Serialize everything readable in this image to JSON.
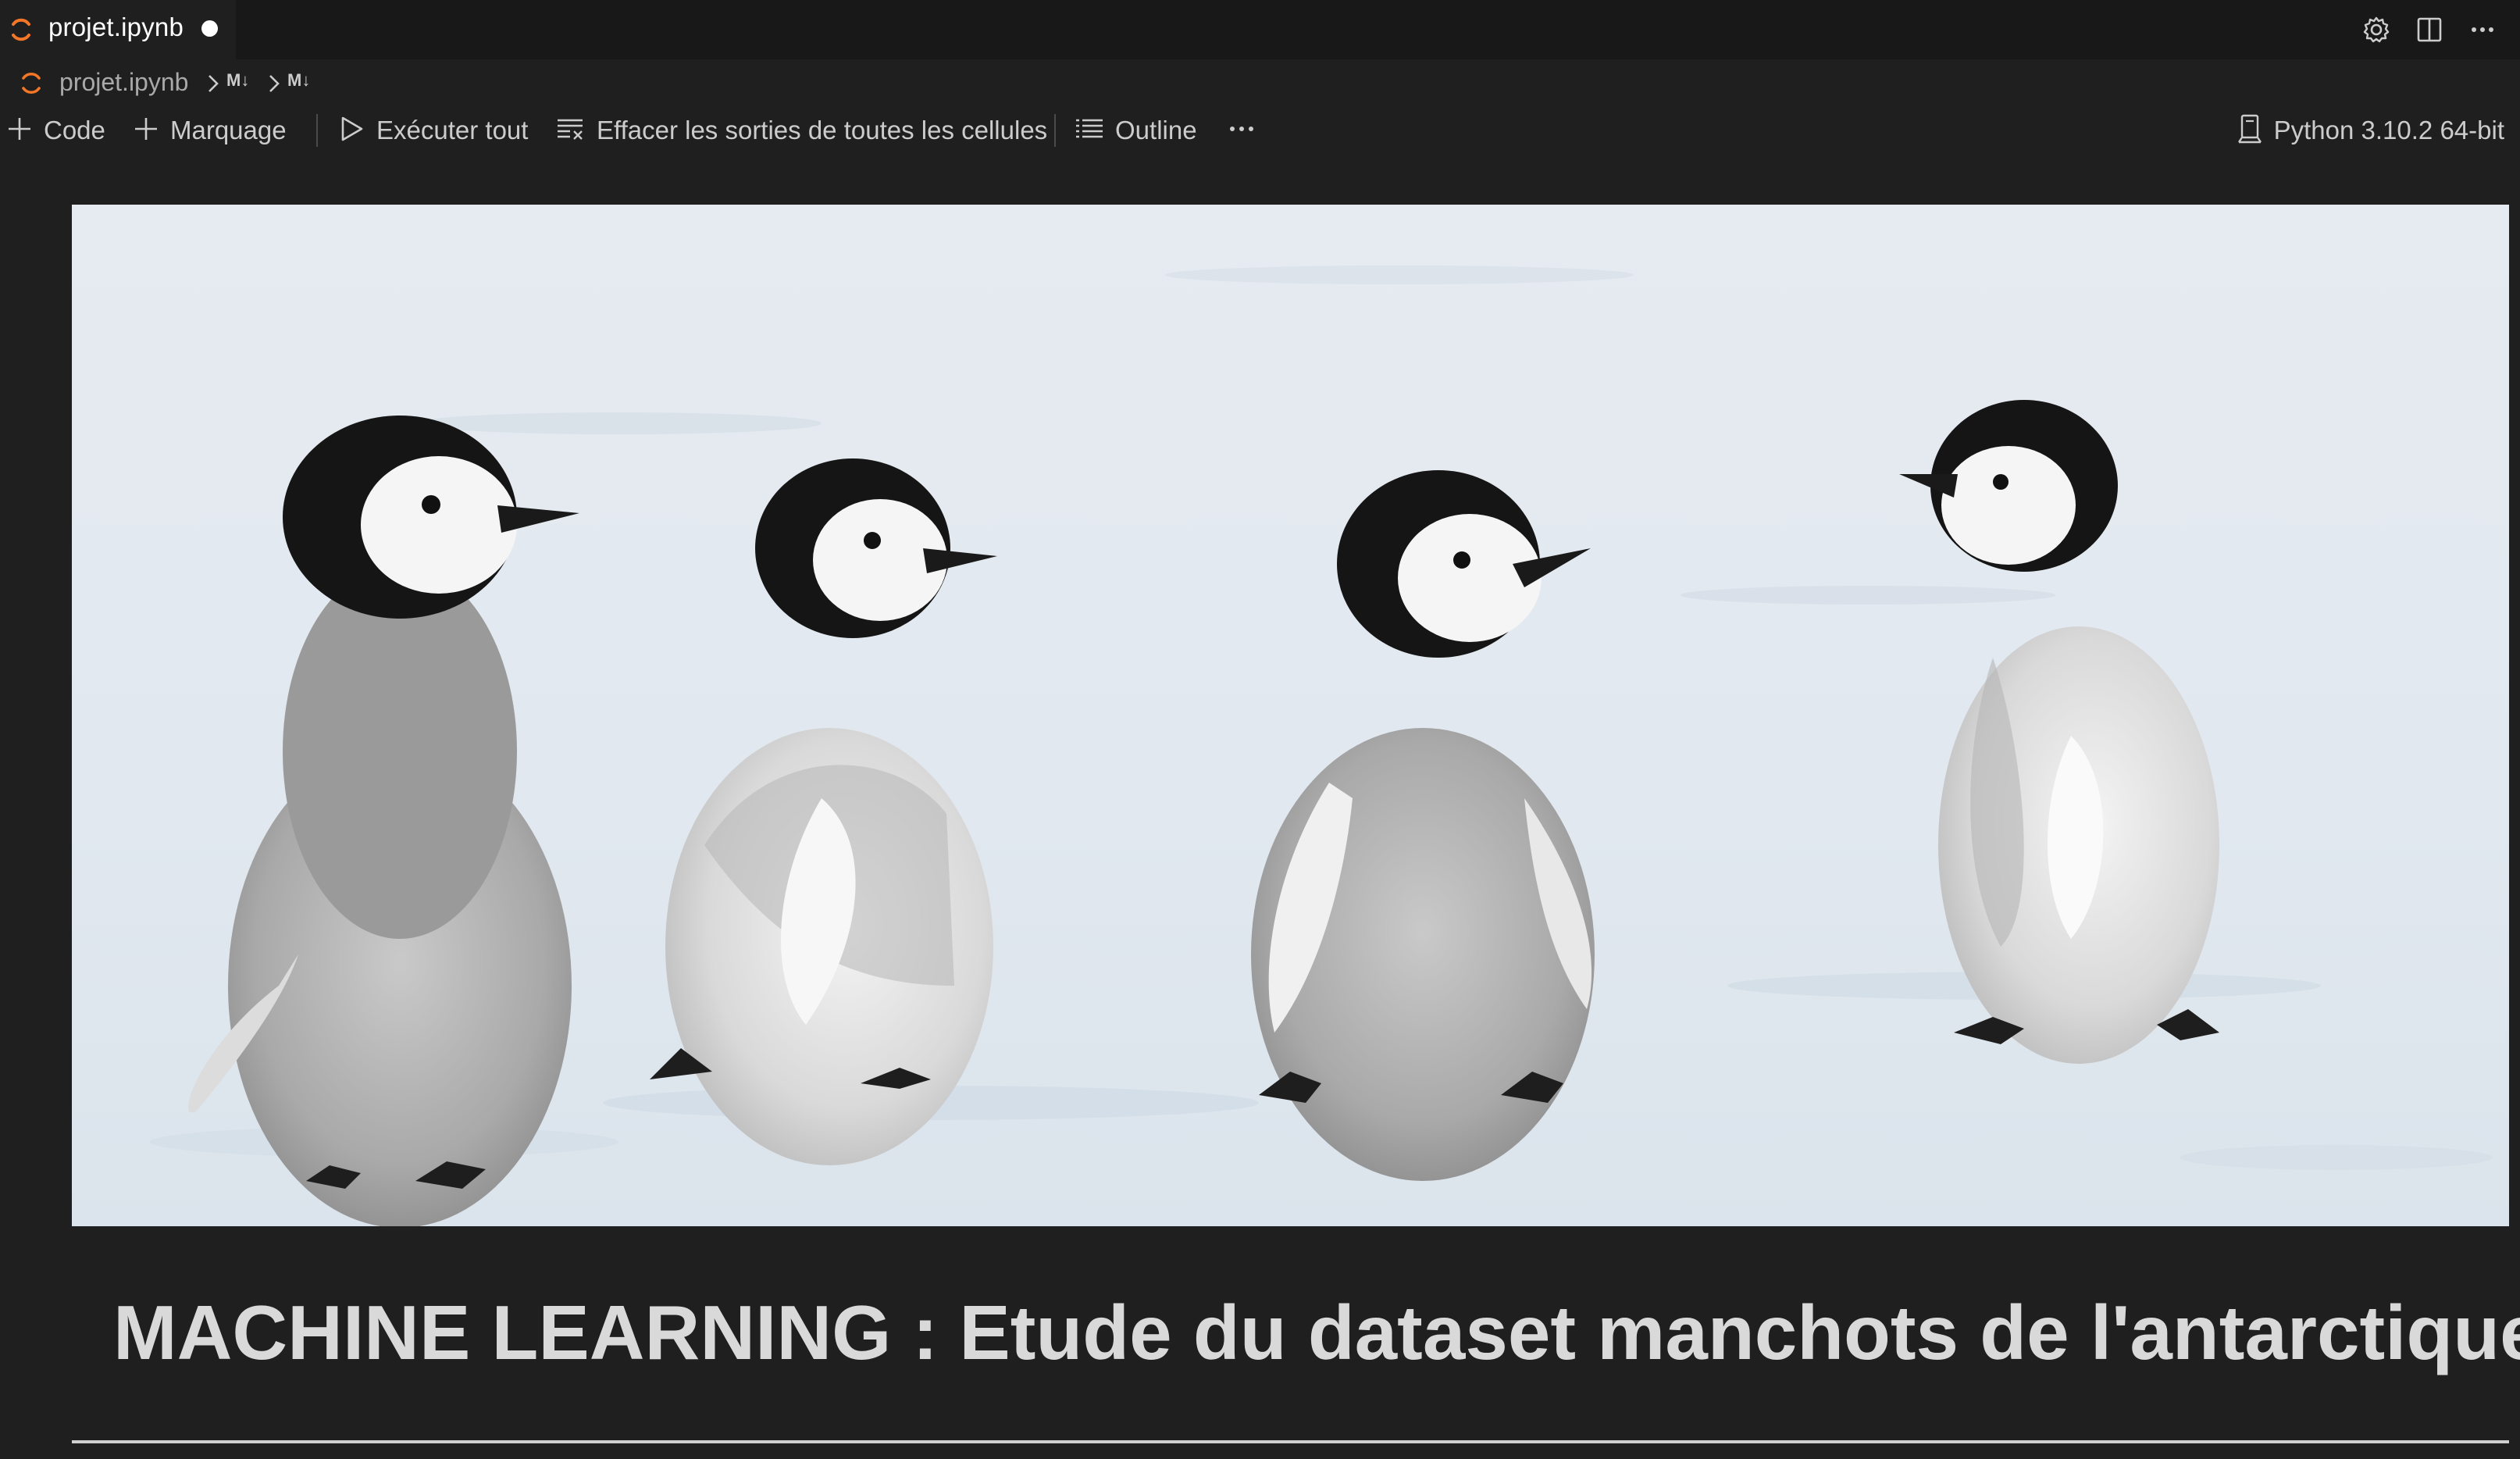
{
  "tab": {
    "title": "projet.ipynb",
    "dirty": true
  },
  "breadcrumb": {
    "file": "projet.ipynb",
    "items": [
      "M↓",
      "M↓"
    ]
  },
  "toolbar": {
    "code_label": "Code",
    "markdown_label": "Marquage",
    "run_all_label": "Exécuter tout",
    "clear_outputs_label": "Effacer les sorties de toutes les cellules",
    "outline_label": "Outline",
    "more_label": "···"
  },
  "kernel": {
    "label": "Python 3.10.2 64-bit"
  },
  "cell": {
    "image_alt": "Emperor penguin chicks walking on ice",
    "heading": "MACHINE LEARNING : Etude du dataset manchots de l'antarctique"
  },
  "colors": {
    "background": "#1f1f1f",
    "tabbar": "#181818",
    "jupyter_orange": "#f37726",
    "text": "#cccccc"
  }
}
